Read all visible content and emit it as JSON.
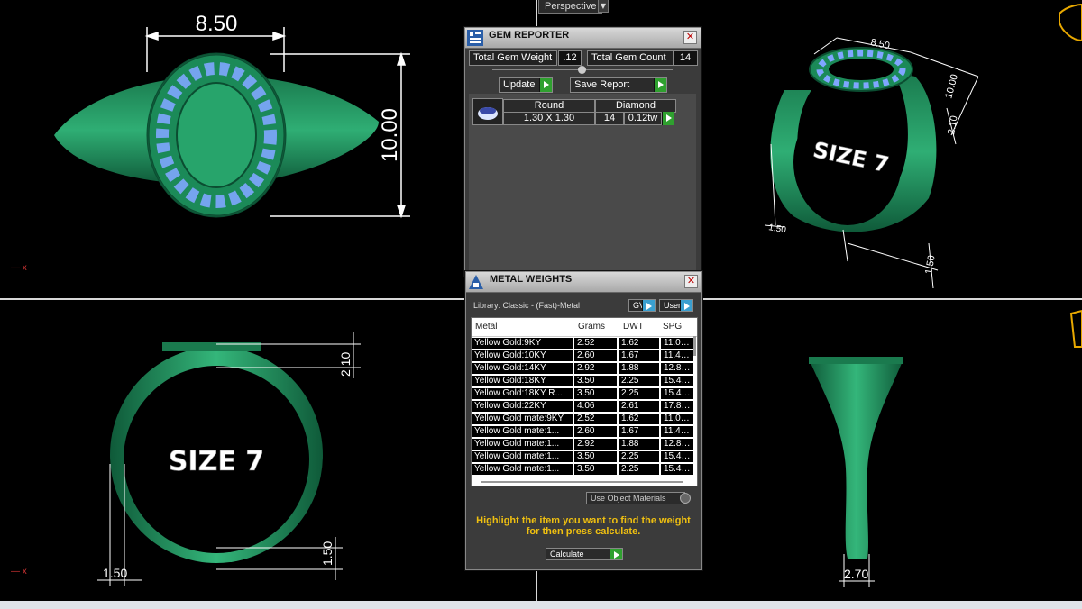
{
  "viewport": {
    "label": "Perspective",
    "colors": {
      "ring": "#1f8a5a",
      "gem": "#7fa6ff",
      "dim": "#ffffff"
    }
  },
  "dimensions": {
    "top_width": "8.50",
    "top_height": "10.00",
    "persp_width": "8.50",
    "persp_height": "10.00",
    "persp_shank_a": "2.10",
    "persp_shank_b": "1.50",
    "persp_shank_c": "1.50",
    "front_top": "2.10",
    "front_bottom": "1.50",
    "front_left": "1.50",
    "side_bottom": "2.70"
  },
  "ring_labels": {
    "size_persp": "SIZE 7",
    "size_front": "SIZE 7"
  },
  "gem_reporter": {
    "title": "GEM REPORTER",
    "total_weight_label": "Total Gem Weight",
    "total_weight_value": ".12",
    "total_count_label": "Total Gem Count",
    "total_count_value": "14",
    "update_label": "Update",
    "save_report_label": "Save Report",
    "gem": {
      "shape": "Round",
      "size": "1.30 X 1.30",
      "type": "Diamond",
      "count": "14",
      "weight": "0.12tw"
    }
  },
  "metal_weights": {
    "title": "METAL WEIGHTS",
    "library": "Library: Classic - (Fast)-Metal",
    "gv_label": "GV",
    "user_label": "User",
    "columns": [
      "Metal",
      "Grams",
      "DWT",
      "SPG"
    ],
    "rows": [
      [
        "Yellow Gold:9KY",
        "2.52",
        "1.62",
        "11.0…"
      ],
      [
        "Yellow Gold:10KY",
        "2.60",
        "1.67",
        "11.4…"
      ],
      [
        "Yellow Gold:14KY",
        "2.92",
        "1.88",
        "12.8…"
      ],
      [
        "Yellow Gold:18KY",
        "3.50",
        "2.25",
        "15.4…"
      ],
      [
        "Yellow Gold:18KY R...",
        "3.50",
        "2.25",
        "15.4…"
      ],
      [
        "Yellow Gold:22KY",
        "4.06",
        "2.61",
        "17.8…"
      ],
      [
        "Yellow Gold mate:9KY",
        "2.52",
        "1.62",
        "11.0…"
      ],
      [
        "Yellow Gold mate:1...",
        "2.60",
        "1.67",
        "11.4…"
      ],
      [
        "Yellow Gold mate:1...",
        "2.92",
        "1.88",
        "12.8…"
      ],
      [
        "Yellow Gold mate:1...",
        "3.50",
        "2.25",
        "15.4…"
      ],
      [
        "Yellow Gold mate:1...",
        "3.50",
        "2.25",
        "15.4…"
      ]
    ],
    "use_object_materials": "Use Object Materials",
    "hint": "Highlight the item you want to find the weight for then press calculate.",
    "calculate_label": "Calculate"
  }
}
